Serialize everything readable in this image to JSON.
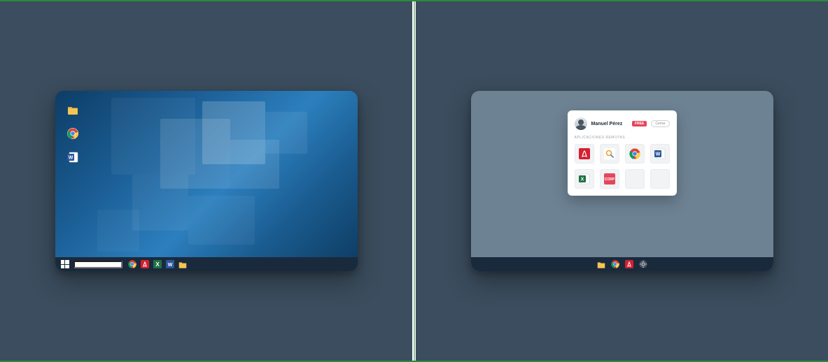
{
  "left": {
    "desktop_icons": [
      "folder",
      "chrome",
      "word"
    ],
    "taskbar": {
      "search_placeholder": "",
      "icons": [
        "chrome",
        "acrobat",
        "excel",
        "word",
        "folder"
      ]
    }
  },
  "right": {
    "panel": {
      "user_name": "Manuel Pérez",
      "badge_label": "FREE",
      "close_label": "Cerrar",
      "section_label": "APLICACIONES REMOTAS",
      "apps": [
        "acrobat",
        "search",
        "chrome",
        "word",
        "excel",
        "corp",
        "blank",
        "blank"
      ]
    },
    "dock": [
      "folder",
      "chrome",
      "acrobat",
      "settings"
    ]
  },
  "icons": {
    "folder": "folder",
    "chrome": "chrome",
    "word": "word",
    "acrobat": "acrobat",
    "excel": "excel",
    "search": "search",
    "corp": "corp",
    "settings": "settings",
    "blank": "blank"
  }
}
